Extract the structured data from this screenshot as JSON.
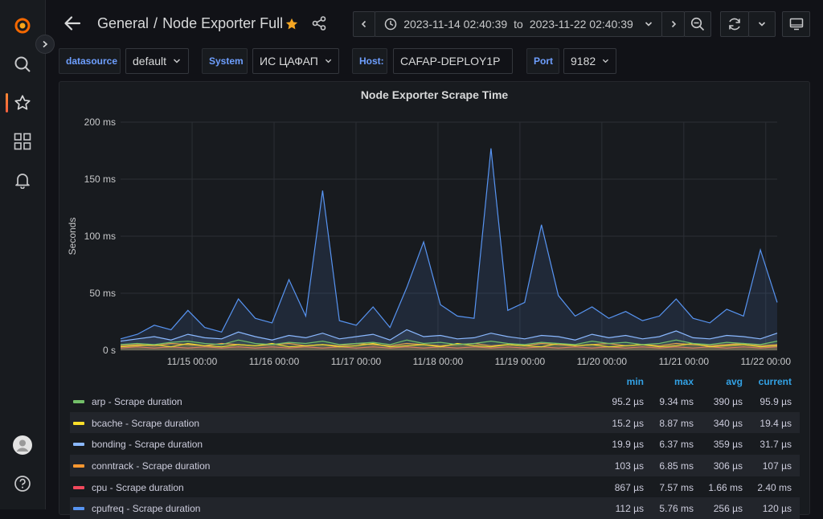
{
  "sidebar": {
    "items": [
      {
        "name": "search",
        "icon": "search-icon"
      },
      {
        "name": "starred",
        "icon": "star-icon"
      },
      {
        "name": "dashboards",
        "icon": "apps-grid-icon"
      },
      {
        "name": "alerting",
        "icon": "bell-icon"
      }
    ]
  },
  "header": {
    "folder": "General",
    "separator": "/",
    "dashboard": "Node Exporter Full",
    "time_from": "2023-11-14 02:40:39",
    "time_to_word": "to",
    "time_to": "2023-11-22 02:40:39"
  },
  "variables": [
    {
      "label": "datasource",
      "value": "default"
    },
    {
      "label": "System",
      "value": "ИС ЦАФАП"
    },
    {
      "label": "Host:",
      "value": "CAFAP-DEPLOY1P"
    },
    {
      "label": "Port",
      "value": "9182"
    }
  ],
  "panel": {
    "title": "Node Exporter Scrape Time"
  },
  "legend": {
    "headers": [
      "min",
      "max",
      "avg",
      "current"
    ],
    "rows": [
      {
        "name": "arp - Scrape duration",
        "color": "#73bf69",
        "min": "95.2 µs",
        "max": "9.34 ms",
        "avg": "390 µs",
        "current": "95.9 µs"
      },
      {
        "name": "bcache - Scrape duration",
        "color": "#fade2a",
        "min": "15.2 µs",
        "max": "8.87 ms",
        "avg": "340 µs",
        "current": "19.4 µs"
      },
      {
        "name": "bonding - Scrape duration",
        "color": "#8ab8ff",
        "min": "19.9 µs",
        "max": "6.37 ms",
        "avg": "359 µs",
        "current": "31.7 µs"
      },
      {
        "name": "conntrack - Scrape duration",
        "color": "#ff9830",
        "min": "103 µs",
        "max": "6.85 ms",
        "avg": "306 µs",
        "current": "107 µs"
      },
      {
        "name": "cpu - Scrape duration",
        "color": "#f2495c",
        "min": "867 µs",
        "max": "7.57 ms",
        "avg": "1.66 ms",
        "current": "2.40 ms"
      },
      {
        "name": "cpufreq - Scrape duration",
        "color": "#5794f2",
        "min": "112 µs",
        "max": "5.76 ms",
        "avg": "256 µs",
        "current": "120 µs"
      }
    ]
  },
  "chart_data": {
    "type": "line",
    "title": "Node Exporter Scrape Time",
    "ylabel": "Seconds",
    "y_unit": "ms",
    "ylim": [
      0,
      200
    ],
    "yticks": [
      "0 s",
      "50 ms",
      "100 ms",
      "150 ms",
      "200 ms"
    ],
    "x_range": [
      "2023-11-14 02:40:39",
      "2023-11-22 02:40:39"
    ],
    "xticks": [
      "11/15 00:00",
      "11/16 00:00",
      "11/17 00:00",
      "11/18 00:00",
      "11/19 00:00",
      "11/20 00:00",
      "11/21 00:00",
      "11/22 00:00"
    ],
    "grid": true,
    "legend_placement": "bottom",
    "series": [
      {
        "name": "arp - Scrape duration",
        "color": "#73bf69",
        "values": [
          5,
          6,
          5,
          7,
          8,
          6,
          5,
          9,
          6,
          5,
          7,
          6,
          8,
          5,
          6,
          7,
          5,
          9,
          6,
          7,
          5,
          6,
          8,
          6,
          5,
          7,
          6,
          5,
          8,
          6,
          7,
          5,
          6,
          9,
          6,
          5,
          7,
          6,
          5,
          8
        ]
      },
      {
        "name": "bcache - Scrape duration",
        "color": "#fade2a",
        "values": [
          3,
          4,
          5,
          3,
          6,
          4,
          3,
          5,
          4,
          6,
          3,
          4,
          5,
          3,
          4,
          6,
          3,
          4,
          5,
          3,
          6,
          4,
          3,
          5,
          4,
          3,
          6,
          4,
          5,
          3,
          4,
          5,
          3,
          4,
          6,
          3,
          4,
          5,
          3,
          4
        ]
      },
      {
        "name": "bonding - Scrape duration",
        "color": "#8ab8ff",
        "values": [
          8,
          10,
          12,
          9,
          14,
          11,
          10,
          16,
          12,
          9,
          13,
          11,
          15,
          10,
          12,
          14,
          9,
          18,
          12,
          13,
          10,
          11,
          15,
          12,
          10,
          13,
          12,
          9,
          14,
          11,
          13,
          10,
          12,
          17,
          11,
          10,
          13,
          12,
          10,
          15
        ]
      },
      {
        "name": "conntrack - Scrape duration",
        "color": "#ff9830",
        "values": [
          4,
          5,
          4,
          6,
          5,
          4,
          6,
          5,
          4,
          5,
          6,
          4,
          5,
          4,
          6,
          5,
          4,
          6,
          5,
          4,
          5,
          6,
          4,
          5,
          4,
          6,
          5,
          4,
          5,
          6,
          4,
          5,
          4,
          6,
          5,
          4,
          5,
          6,
          4,
          5
        ]
      },
      {
        "name": "cpu - Scrape duration",
        "color": "#f2495c",
        "values": [
          2,
          3,
          2,
          3,
          2,
          3,
          2,
          3,
          2,
          3,
          2,
          3,
          2,
          3,
          2,
          3,
          2,
          3,
          2,
          3,
          2,
          3,
          2,
          3,
          2,
          3,
          2,
          3,
          2,
          3,
          2,
          3,
          2,
          3,
          2,
          3,
          2,
          3,
          2,
          3
        ]
      },
      {
        "name": "cpufreq - Scrape duration",
        "color": "#5794f2",
        "values": [
          10,
          14,
          22,
          18,
          35,
          20,
          16,
          45,
          28,
          24,
          62,
          30,
          140,
          26,
          22,
          38,
          20,
          55,
          95,
          40,
          30,
          28,
          177,
          35,
          42,
          110,
          48,
          30,
          38,
          28,
          34,
          26,
          30,
          45,
          28,
          24,
          36,
          30,
          88,
          42
        ]
      }
    ]
  }
}
